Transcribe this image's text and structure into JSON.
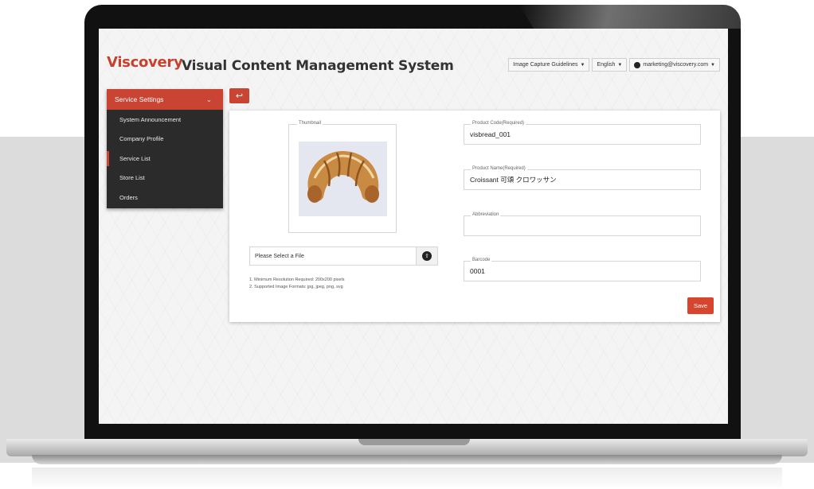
{
  "brand": {
    "logo_text": "Viscovery",
    "app_title": "Visual Content Management System",
    "accent": "#c94432"
  },
  "top_nav": {
    "guidelines": "Image Capture Guidelines",
    "language": "English",
    "account": "marketing@viscovery.com"
  },
  "sidebar": {
    "header": "Service Settings",
    "items": [
      {
        "label": "System Announcement"
      },
      {
        "label": "Company Profile"
      },
      {
        "label": "Service List"
      },
      {
        "label": "Store List"
      },
      {
        "label": "Orders"
      }
    ]
  },
  "form": {
    "thumbnail_label": "Thumbnail",
    "thumbnail_icon": "croissant-image",
    "file_placeholder": "Please Select a File",
    "hints": [
      "1. Minimum Resolution Required: 200x200 pixels",
      "2. Supported Image Formats: jpg, jpeg, png, svg"
    ],
    "fields": [
      {
        "label": "Product Code(Required)",
        "value": "visbread_001"
      },
      {
        "label": "Product Name(Required)",
        "value": "Croissant 可頌 クロワッサン"
      },
      {
        "label": "Abbreviation",
        "value": ""
      },
      {
        "label": "Barcode",
        "value": "0001"
      }
    ],
    "save_label": "Save"
  }
}
